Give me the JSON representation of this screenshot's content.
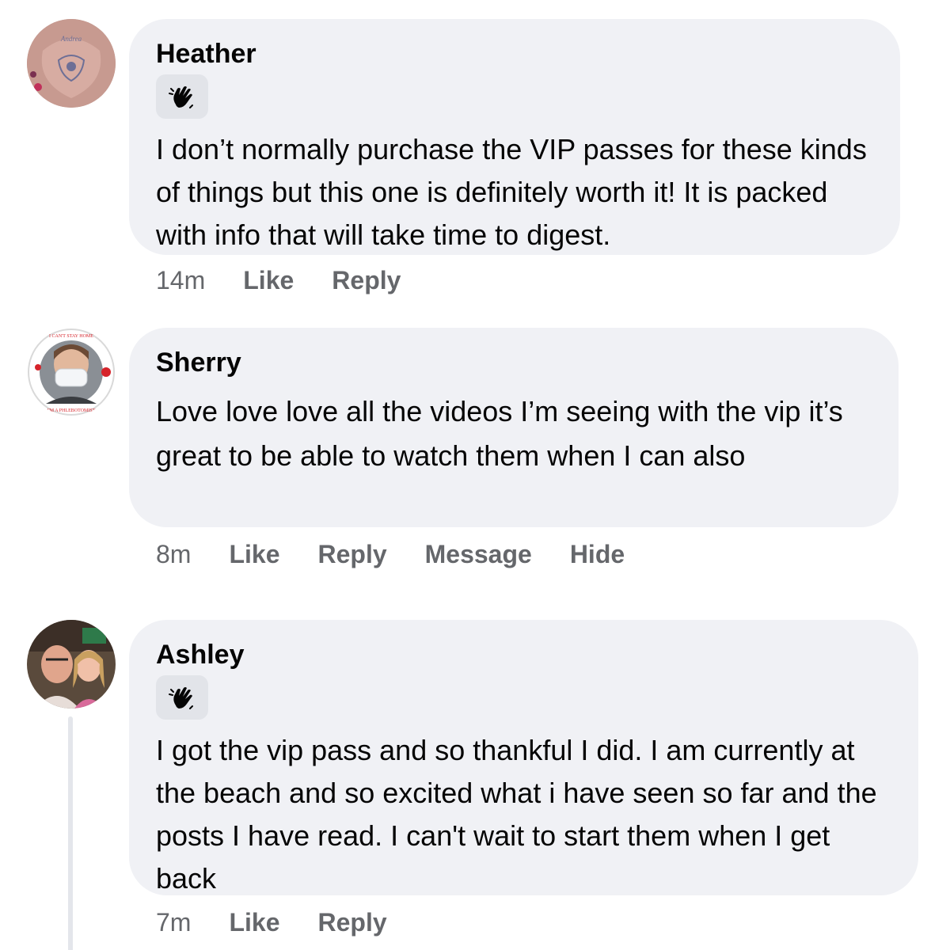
{
  "comments": [
    {
      "author": "Heather",
      "has_badge": true,
      "badge_icon": "waving-hand-icon",
      "text": "I don’t normally purchase the VIP passes for these kinds of things but this one is definitely worth it! It is packed with info that will take time to digest.",
      "time": "14m",
      "actions": [
        "Like",
        "Reply"
      ]
    },
    {
      "author": "Sherry",
      "has_badge": false,
      "text": "Love love love all the videos I’m seeing with the vip it’s great to be able to watch them when I can also",
      "time": "8m",
      "actions": [
        "Like",
        "Reply",
        "Message",
        "Hide"
      ]
    },
    {
      "author": "Ashley",
      "has_badge": true,
      "badge_icon": "waving-hand-icon",
      "text": "I got the vip pass and so thankful I did. I am currently at the beach and so excited what i have seen so far and the posts I have read. I can't wait to start them when I get back",
      "time": "7m",
      "actions": [
        "Like",
        "Reply"
      ]
    }
  ],
  "colors": {
    "bubble": "#f0f1f5",
    "badge": "#e2e4e9",
    "meta_text": "#65676b",
    "text": "#050505",
    "thread_line": "#e4e6eb"
  }
}
